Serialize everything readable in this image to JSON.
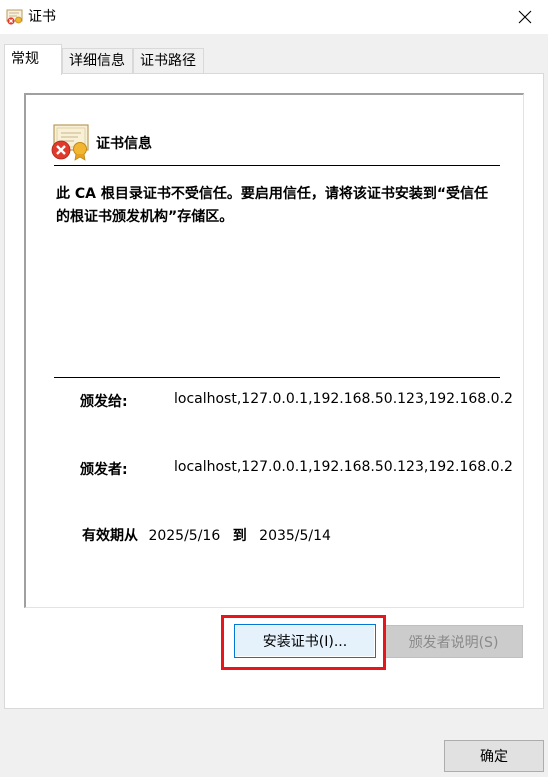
{
  "window": {
    "title": "证书",
    "close_icon": "close-icon"
  },
  "tabs": [
    {
      "label": "常规",
      "active": true
    },
    {
      "label": "详细信息",
      "active": false
    },
    {
      "label": "证书路径",
      "active": false
    }
  ],
  "general": {
    "info_title": "证书信息",
    "warning": "此 CA 根目录证书不受信任。要启用信任，请将该证书安装到“受信任的根证书颁发机构”存储区。",
    "issued_to_label": "颁发给:",
    "issued_to_value": "localhost,127.0.0.1,192.168.50.123,192.168.0.2",
    "issued_by_label": "颁发者:",
    "issued_by_value": "localhost,127.0.0.1,192.168.50.123,192.168.0.2",
    "valid_from_label": "有效期从",
    "valid_from": "2025/5/16",
    "valid_to_label": "到",
    "valid_to": "2035/5/14",
    "install_button": "安装证书(I)...",
    "issuer_statement_button": "颁发者说明(S)"
  },
  "footer": {
    "ok_button": "确定"
  },
  "colors": {
    "highlight": "#e8151b",
    "focus_border": "#0078d7",
    "error_red": "#e03a2b"
  }
}
